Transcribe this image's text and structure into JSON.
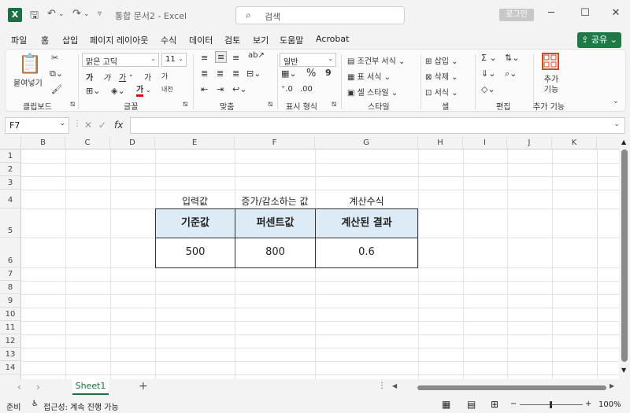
{
  "titlebar": {
    "app_icon": "X",
    "doc_title": "통합 문서2 - Excel",
    "search_placeholder": "검색",
    "login": "로그인",
    "icons": [
      "save-icon",
      "undo-icon",
      "redo-icon",
      "customize-icon",
      "search-icon",
      "minimize-icon",
      "restore-icon",
      "close-icon"
    ]
  },
  "menu": {
    "tabs": [
      "파일",
      "홈",
      "삽입",
      "페이지 레이아웃",
      "수식",
      "데이터",
      "검토",
      "보기",
      "도움말",
      "Acrobat"
    ],
    "active": "홈",
    "share": "공유"
  },
  "ribbon": {
    "clipboard": {
      "paste": "붙여넣기",
      "label": "클립보드"
    },
    "font": {
      "name": "맑은 고딕",
      "size": "11",
      "label": "글꼴",
      "bold": "가",
      "italic": "가",
      "underline": "가",
      "grow": "가",
      "shrink": "가",
      "color": "가",
      "phonetic": "내천"
    },
    "align": {
      "label": "맞춤"
    },
    "number": {
      "format": "일반",
      "percent": "%",
      "comma": "9",
      "label": "표시 형식"
    },
    "styles": {
      "conditional": "조건부 서식",
      "table": "표 서식",
      "cell": "셀 스타일",
      "label": "스타일"
    },
    "cells": {
      "insert": "삽입",
      "delete": "삭제",
      "format": "서식",
      "label": "셀"
    },
    "edit": {
      "sum": "Σ",
      "label": "편집"
    },
    "addins": {
      "button": "추가 기능",
      "label": "추가 기능"
    }
  },
  "formula_bar": {
    "name_box": "F7",
    "cancel": "✕",
    "enter": "✓",
    "fx": "fx",
    "formula": ""
  },
  "grid": {
    "columns": [
      "B",
      "C",
      "D",
      "E",
      "F",
      "G",
      "H",
      "I",
      "J",
      "K"
    ],
    "rows": [
      "1",
      "2",
      "3",
      "4",
      "5",
      "6",
      "7",
      "8",
      "9",
      "10",
      "11",
      "12",
      "13",
      "14"
    ],
    "row4_labels": [
      "입력값",
      "증가/감소하는 값",
      "계산수식"
    ],
    "headers": [
      "기준값",
      "퍼센트값",
      "계산된 결과"
    ],
    "values": [
      "500",
      "800",
      "0.6"
    ]
  },
  "sheet_tabs": {
    "active": "Sheet1",
    "add": "+"
  },
  "status": {
    "ready": "준비",
    "accessibility": "접근성: 계속 진행 가능",
    "zoom": "100%"
  }
}
